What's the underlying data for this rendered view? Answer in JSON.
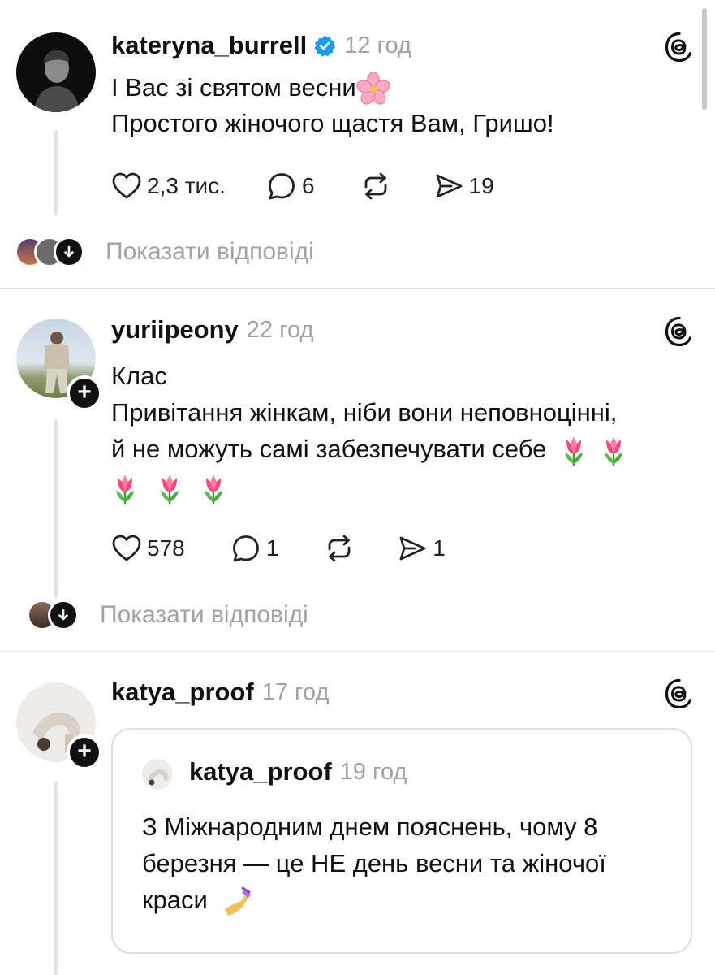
{
  "posts": [
    {
      "username": "kateryna_burrell",
      "verified": true,
      "time": "12 год",
      "lines": [
        "І Вас зі святом весни",
        "Простого жіночого щастя Вам, Гришо!"
      ],
      "likes": "2,3 тис.",
      "comments": "6",
      "shares": "19",
      "show_replies": "Показати відповіді"
    },
    {
      "username": "yuriipeony",
      "time": "22 год",
      "lines": [
        "Клас",
        "Привітання жінкам, ніби вони неповноцінні,",
        "й не можуть самі забезпечувати себе"
      ],
      "likes": "578",
      "comments": "1",
      "shares": "1",
      "show_replies": "Показати відповіді"
    },
    {
      "username": "katya_proof",
      "time": "17 год",
      "quote": {
        "username": "katya_proof",
        "time": "19 год",
        "lines": [
          "З Міжнародним днем пояснень, чому 8",
          "березня — це НЕ день весни та жіночої",
          "краси"
        ]
      }
    }
  ],
  "colors": {
    "text": "#111111",
    "muted": "#a2a2a2",
    "verified": "#1d9bf0",
    "divider": "#e5e5e5"
  },
  "icons": [
    "threads-icon",
    "verified-icon",
    "heart-icon",
    "comment-icon",
    "repost-icon",
    "share-icon",
    "chevron-down-icon",
    "plus-icon",
    "flower-emoji-icon",
    "tulip-emoji-icon",
    "nail-polish-emoji-icon"
  ]
}
